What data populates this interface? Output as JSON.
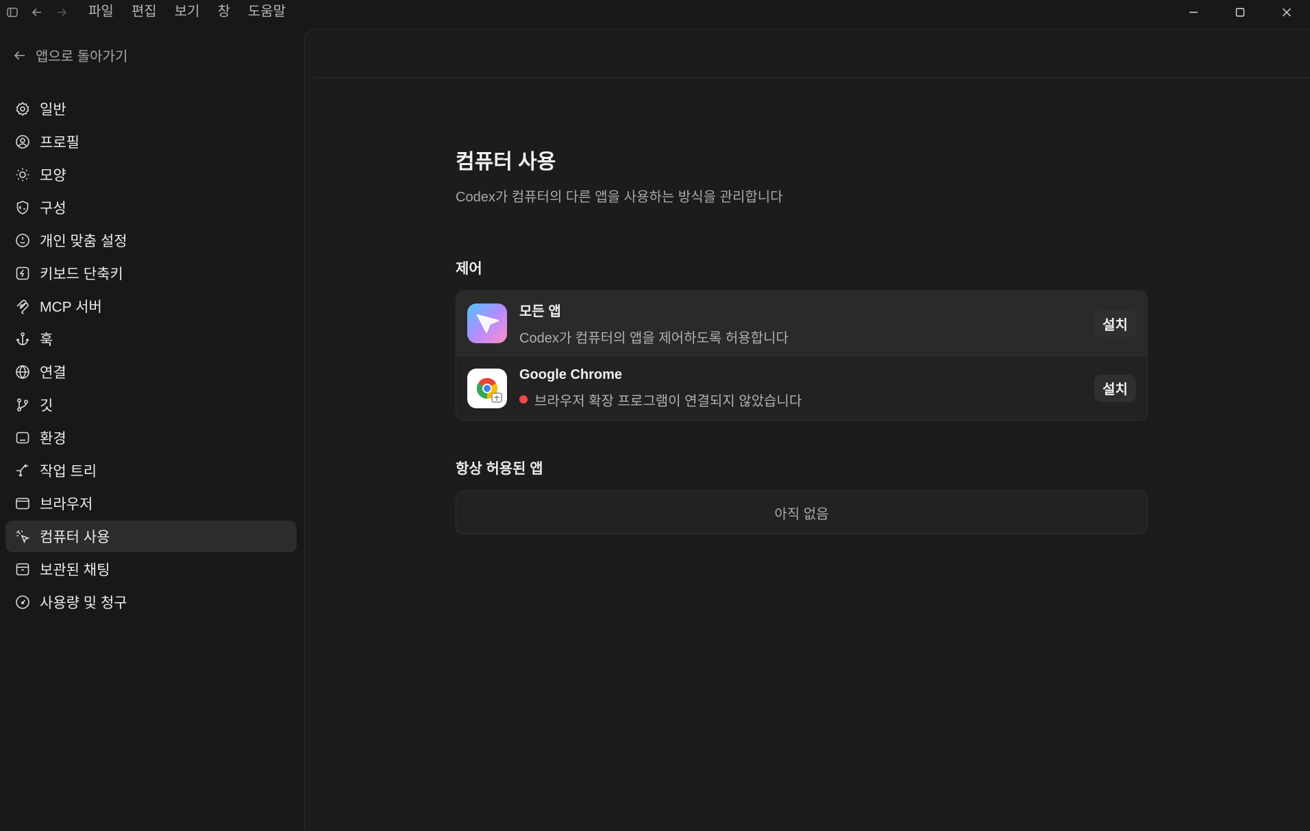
{
  "titlebar": {
    "menu": [
      "파일",
      "편집",
      "보기",
      "창",
      "도움말"
    ]
  },
  "sidebar": {
    "back_label": "앱으로 돌아가기",
    "items": [
      {
        "label": "일반",
        "icon": "gear-icon"
      },
      {
        "label": "프로필",
        "icon": "user-circle-icon"
      },
      {
        "label": "모양",
        "icon": "sun-icon"
      },
      {
        "label": "구성",
        "icon": "shield-code-icon"
      },
      {
        "label": "개인 맞춤 설정",
        "icon": "smile-clock-icon"
      },
      {
        "label": "키보드 단축키",
        "icon": "bolt-key-icon"
      },
      {
        "label": "MCP 서버",
        "icon": "mcp-icon"
      },
      {
        "label": "훅",
        "icon": "anchor-icon"
      },
      {
        "label": "연결",
        "icon": "globe-icon"
      },
      {
        "label": "깃",
        "icon": "git-branch-icon"
      },
      {
        "label": "환경",
        "icon": "terminal-box-icon"
      },
      {
        "label": "작업 트리",
        "icon": "worktree-icon"
      },
      {
        "label": "브라우저",
        "icon": "browser-window-icon"
      },
      {
        "label": "컴퓨터 사용",
        "icon": "cursor-sparkle-icon",
        "active": true
      },
      {
        "label": "보관된 채팅",
        "icon": "archive-icon"
      },
      {
        "label": "사용량 및 청구",
        "icon": "gauge-icon"
      }
    ]
  },
  "main": {
    "title": "컴퓨터 사용",
    "subtitle": "Codex가 컴퓨터의 다른 앱을 사용하는 방식을 관리합니다",
    "control": {
      "heading": "제어",
      "rows": [
        {
          "title": "모든 앱",
          "desc": "Codex가 컴퓨터의 앱을 제어하도록 허용합니다",
          "button": "설치",
          "icon": "all-apps-icon"
        },
        {
          "title": "Google Chrome",
          "desc": "브라우저 확장 프로그램이 연결되지 않았습니다",
          "button": "설치",
          "icon": "chrome-icon",
          "status_color": "#f04848"
        }
      ]
    },
    "always_allowed": {
      "heading": "항상 허용된 앱",
      "empty": "아직 없음"
    }
  }
}
